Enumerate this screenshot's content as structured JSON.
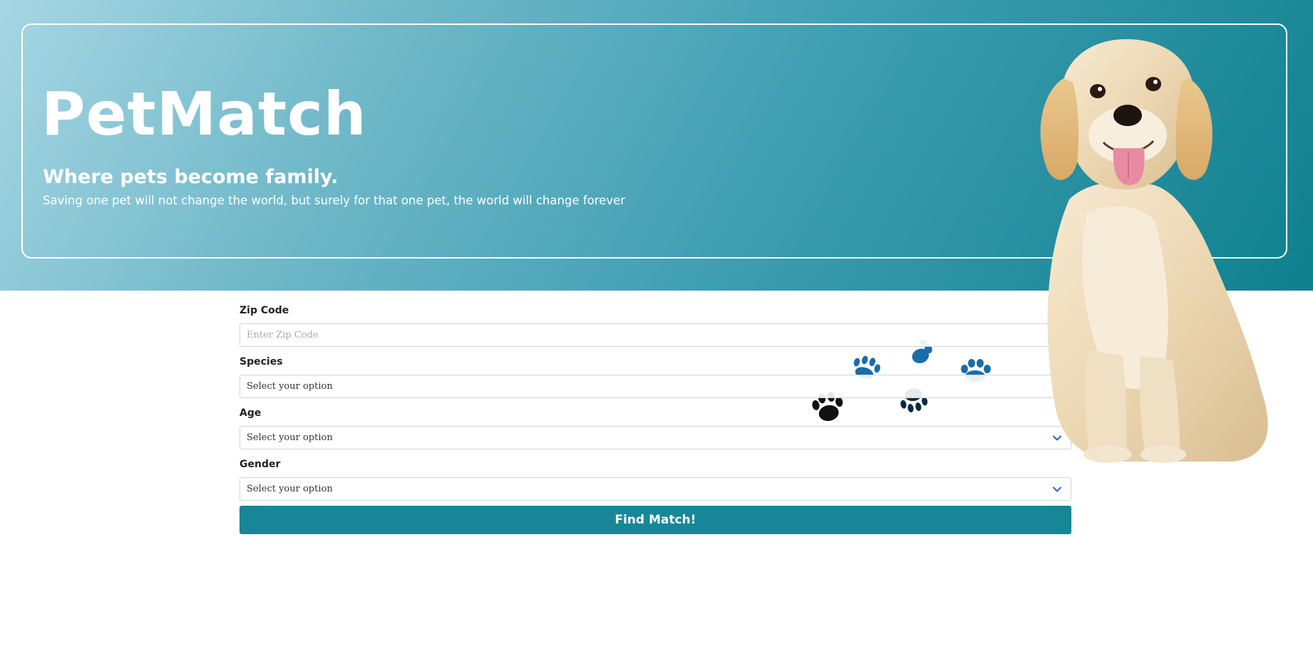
{
  "hero": {
    "title": "PetMatch",
    "tagline": "Where pets become family.",
    "quote": "Saving one pet will not change the world, but surely for that one pet, the world will change forever"
  },
  "form": {
    "zip": {
      "label": "Zip Code",
      "placeholder": "Enter Zip Code"
    },
    "species": {
      "label": "Species",
      "selected": "Select your option"
    },
    "age": {
      "label": "Age",
      "selected": "Select your option"
    },
    "gender": {
      "label": "Gender",
      "selected": "Select your option"
    },
    "submit_label": "Find Match!"
  },
  "icons": {
    "paw": "paw-print-icon",
    "chevron": "chevron-down-icon"
  },
  "colors": {
    "accent": "#178797",
    "hero_dark": "#0e808e",
    "hero_light": "#a7d6e4",
    "chevron": "#2f5fd0"
  }
}
